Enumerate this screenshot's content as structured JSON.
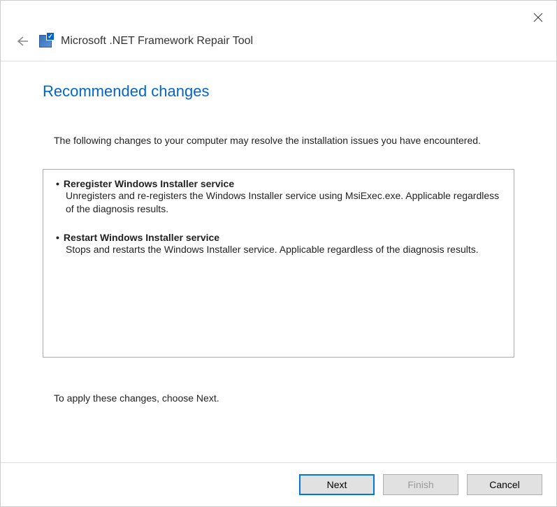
{
  "window": {
    "title": "Microsoft .NET Framework Repair Tool"
  },
  "page": {
    "heading": "Recommended changes",
    "intro": "The following changes to your computer may resolve the installation issues you have encountered.",
    "footer": "To apply these changes, choose Next."
  },
  "changes": [
    {
      "title": "Reregister Windows Installer service",
      "description": "Unregisters and re-registers the Windows Installer service using MsiExec.exe. Applicable regardless of the diagnosis results."
    },
    {
      "title": "Restart Windows Installer service",
      "description": "Stops and restarts the Windows Installer service. Applicable regardless of the diagnosis results."
    }
  ],
  "buttons": {
    "next": "Next",
    "finish": "Finish",
    "cancel": "Cancel"
  }
}
